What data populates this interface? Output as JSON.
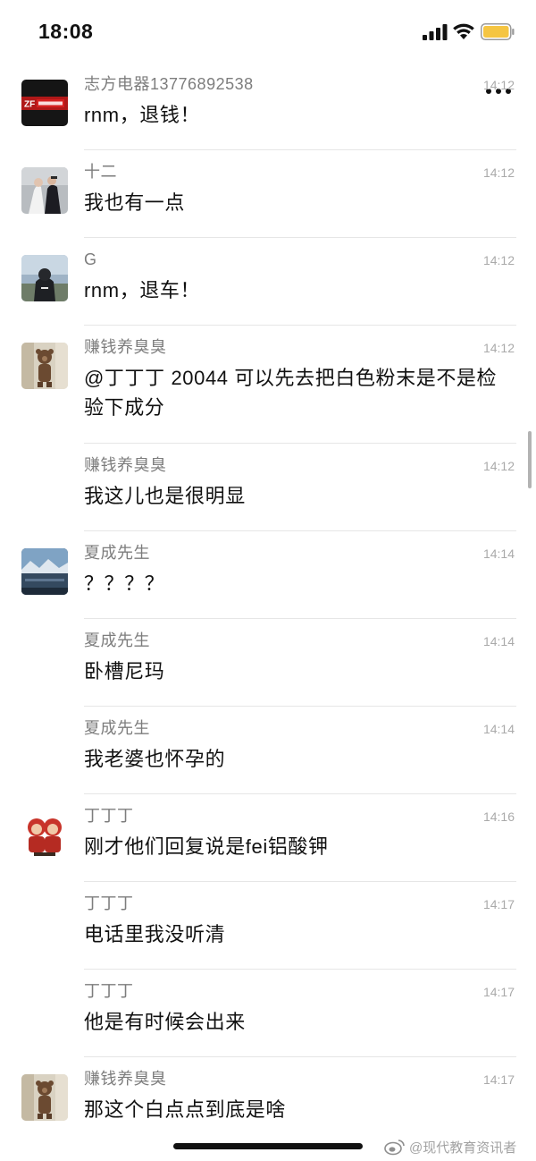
{
  "status_bar": {
    "time": "18:08",
    "signal_icon": "cellular-signal-icon",
    "wifi_icon": "wifi-icon",
    "battery_icon": "battery-icon",
    "battery_color": "#f5c542"
  },
  "header": {
    "more_icon": "more-icon"
  },
  "messages": [
    {
      "sender": "志方电器13776892538",
      "time": "14:12",
      "text": "rnm，退钱！",
      "avatar": "brand-logo"
    },
    {
      "sender": "十二",
      "time": "14:12",
      "text": "我也有一点",
      "avatar": "couple-photo"
    },
    {
      "sender": "G",
      "time": "14:12",
      "text": "rnm，退车！",
      "avatar": "person-photo"
    },
    {
      "sender": "赚钱养臭臭",
      "time": "14:12",
      "text": "@丁丁丁 20044 可以先去把白色粉末是不是检验下成分",
      "avatar": "bear-photo"
    },
    {
      "sender": "赚钱养臭臭",
      "time": "14:12",
      "text": "我这儿也是很明显",
      "avatar": null
    },
    {
      "sender": "夏成先生",
      "time": "14:14",
      "text": "？？？？",
      "avatar": "landscape-photo"
    },
    {
      "sender": "夏成先生",
      "time": "14:14",
      "text": "卧槽尼玛",
      "avatar": null
    },
    {
      "sender": "夏成先生",
      "time": "14:14",
      "text": "我老婆也怀孕的",
      "avatar": null
    },
    {
      "sender": "丁丁丁",
      "time": "14:16",
      "text": "刚才他们回复说是fei铝酸钾",
      "avatar": "cartoon-photo"
    },
    {
      "sender": "丁丁丁",
      "time": "14:17",
      "text": "电话里我没听清",
      "avatar": null
    },
    {
      "sender": "丁丁丁",
      "time": "14:17",
      "text": "他是有时候会出来",
      "avatar": null
    },
    {
      "sender": "赚钱养臭臭",
      "time": "14:17",
      "text": "那这个白点点到底是啥",
      "avatar": "bear-photo"
    }
  ],
  "watermark": {
    "text": "@现代教育资讯者",
    "logo": "weibo-logo-icon"
  }
}
